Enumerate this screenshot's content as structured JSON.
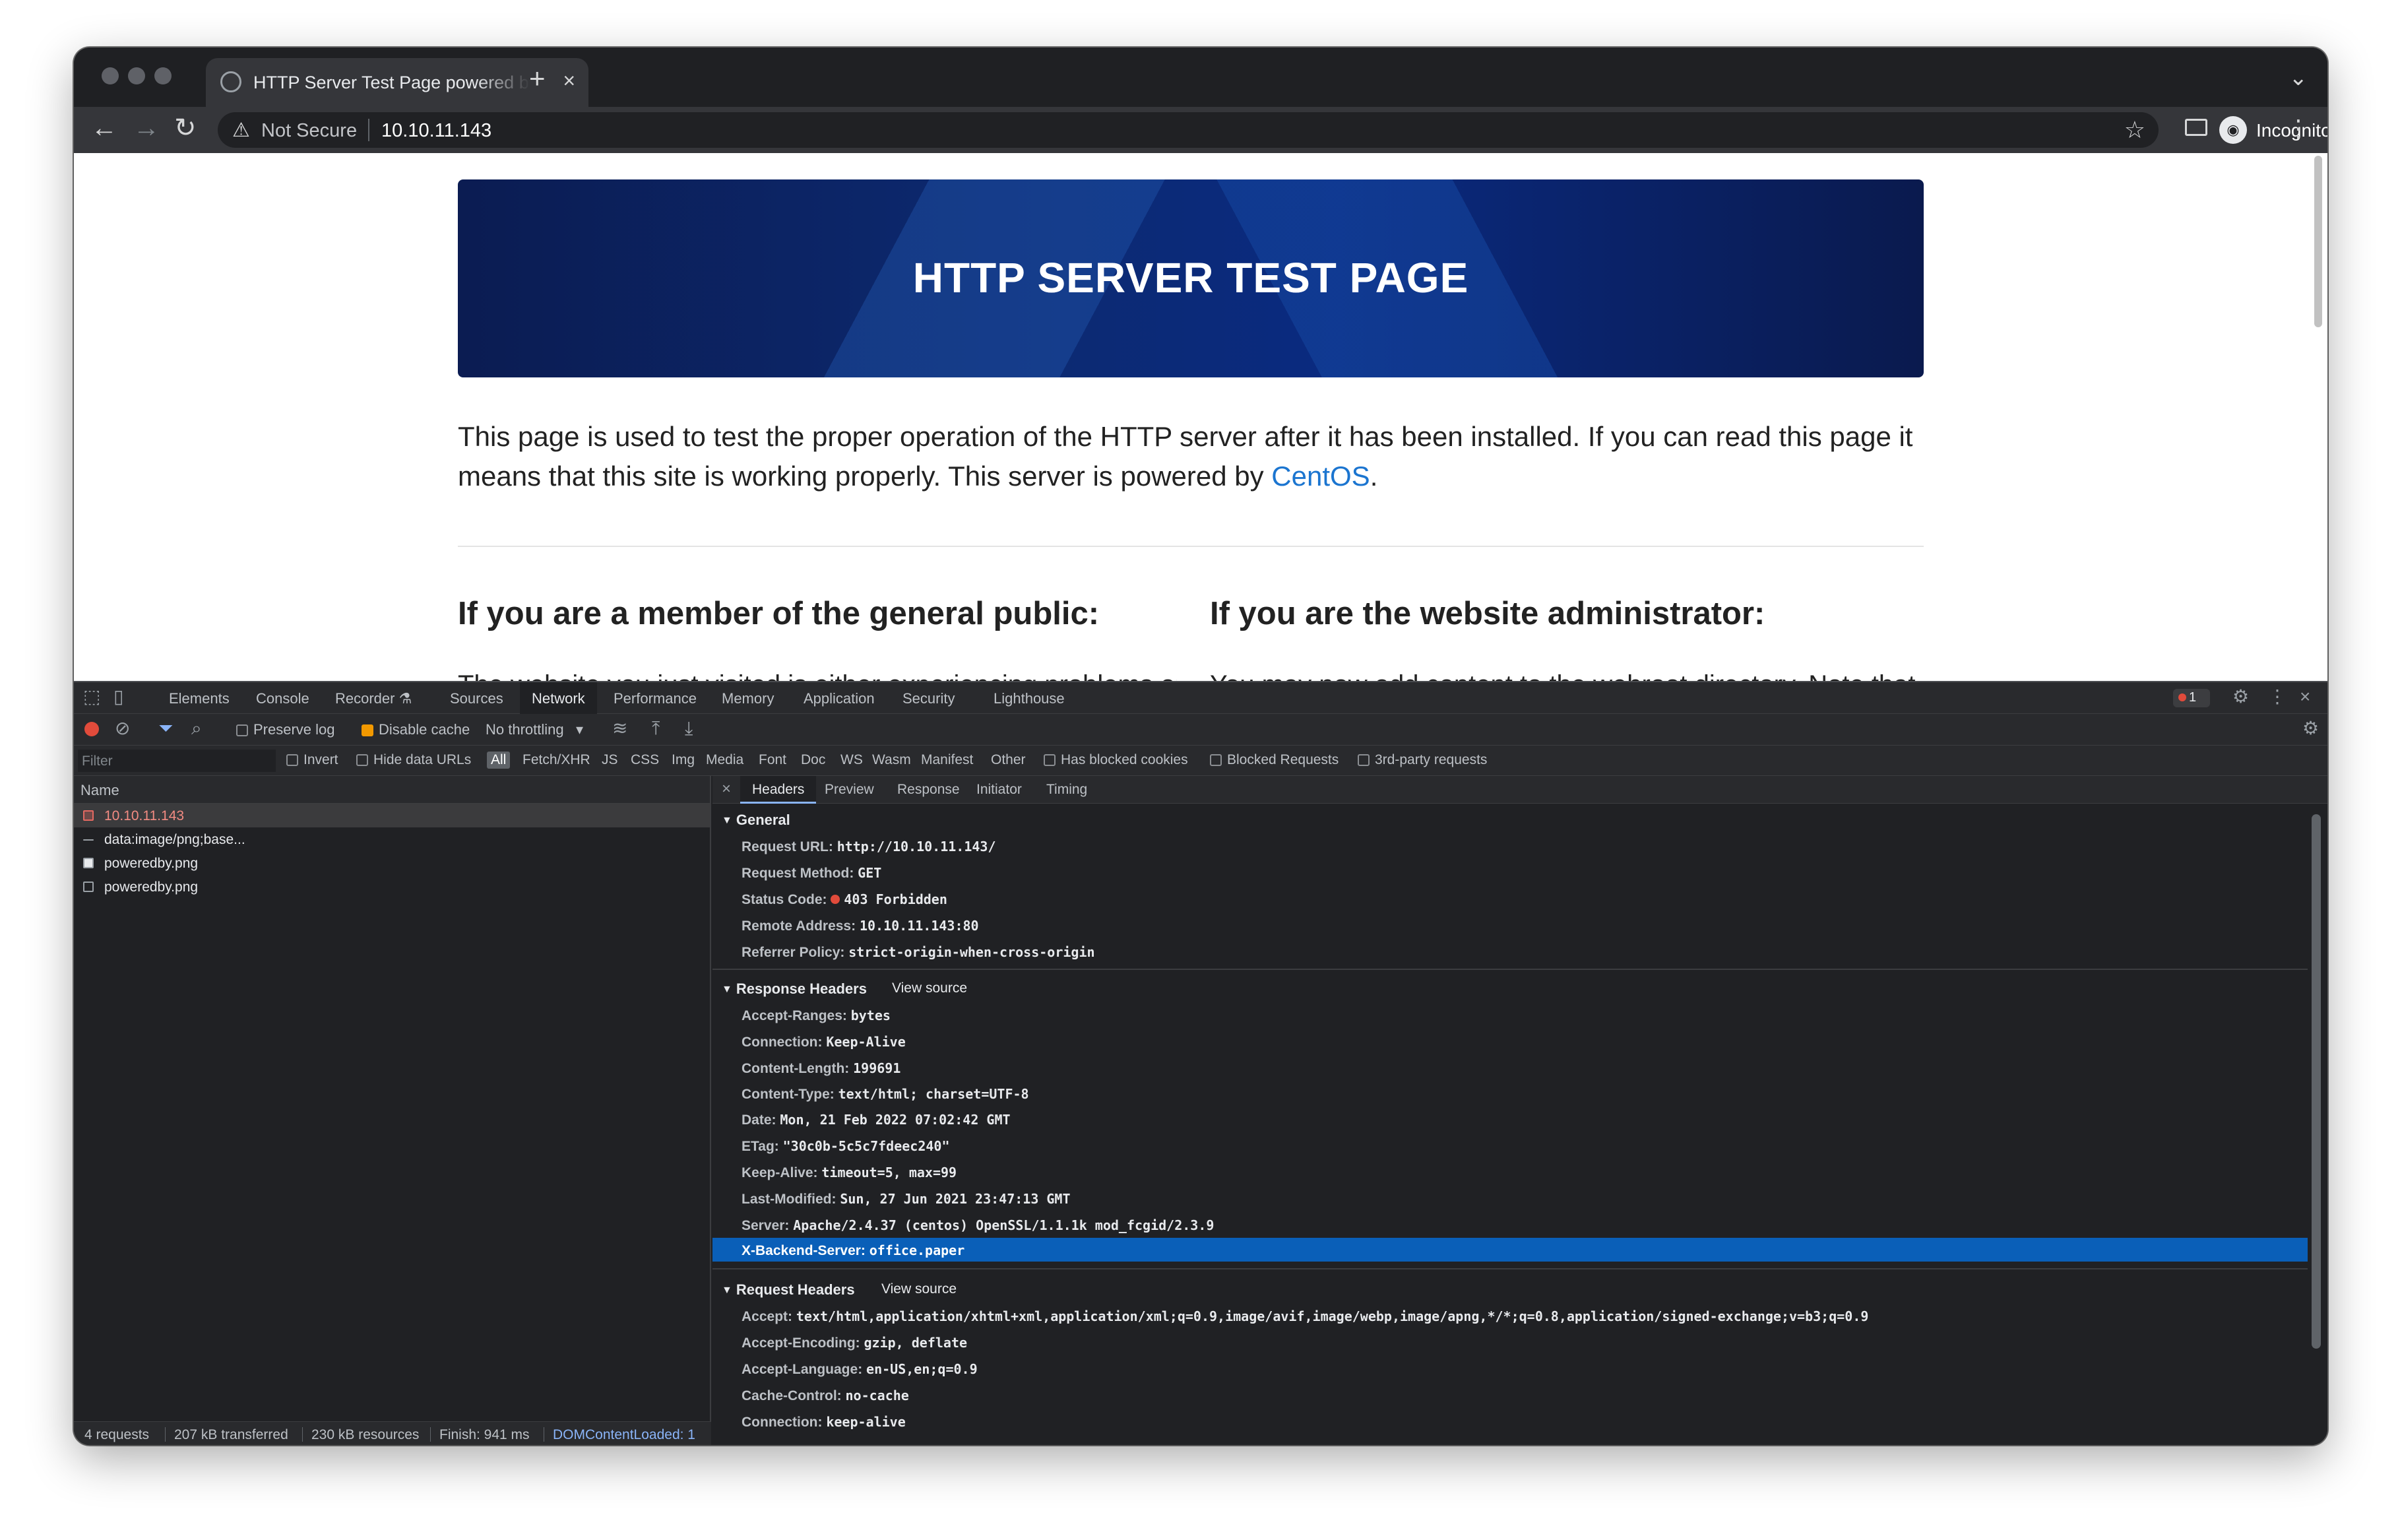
{
  "browser": {
    "tab_title": "HTTP Server Test Page powered by CentOS",
    "address": {
      "security_label": "Not Secure",
      "url": "10.10.11.143"
    },
    "profile_label": "Incognito"
  },
  "page": {
    "banner_title": "HTTP SERVER TEST PAGE",
    "intro_text": "This page is used to test the proper operation of the HTTP server after it has been installed. If you can read this page it means that this site is working properly. This server is powered by ",
    "intro_link": "CentOS",
    "intro_end": ".",
    "public_heading": "If you are a member of the general public:",
    "admin_heading": "If you are the website administrator:",
    "public_cut_text": "The website you just visited is either experiencing problems or",
    "admin_cut_text": "You may now add content to the webroot directory. Note that"
  },
  "devtools": {
    "tabs": [
      "Elements",
      "Console",
      "Recorder ⚗",
      "Sources",
      "Network",
      "Performance",
      "Memory",
      "Application",
      "Security",
      "Lighthouse"
    ],
    "active_tab": "Network",
    "error_count": "1",
    "toolbar": {
      "preserve_log": "Preserve log",
      "disable_cache": "Disable cache",
      "throttling": "No throttling"
    },
    "filter": {
      "placeholder": "Filter",
      "invert": "Invert",
      "hide_data_urls": "Hide data URLs",
      "types": [
        "All",
        "Fetch/XHR",
        "JS",
        "CSS",
        "Img",
        "Media",
        "Font",
        "Doc",
        "WS",
        "Wasm",
        "Manifest",
        "Other"
      ],
      "has_blocked_cookies": "Has blocked cookies",
      "blocked_requests": "Blocked Requests",
      "third_party": "3rd-party requests"
    },
    "requests": {
      "column": "Name",
      "rows": [
        "10.10.11.143",
        "data:image/png;base...",
        "poweredby.png",
        "poweredby.png"
      ]
    },
    "status_bar": {
      "requests": "4 requests",
      "transferred": "207 kB transferred",
      "resources": "230 kB resources",
      "finish": "Finish: 941 ms",
      "dom_loaded": "DOMContentLoaded: 1"
    },
    "details": {
      "tabs": [
        "Headers",
        "Preview",
        "Response",
        "Initiator",
        "Timing"
      ],
      "active_tab": "Headers",
      "view_source": "View source",
      "general": {
        "title": "General",
        "rows": [
          {
            "k": "Request URL:",
            "v": "http://10.10.11.143/"
          },
          {
            "k": "Request Method:",
            "v": "GET"
          },
          {
            "k": "Status Code:",
            "v": "403 Forbidden"
          },
          {
            "k": "Remote Address:",
            "v": "10.10.11.143:80"
          },
          {
            "k": "Referrer Policy:",
            "v": "strict-origin-when-cross-origin"
          }
        ]
      },
      "response": {
        "title": "Response Headers",
        "rows": [
          {
            "k": "Accept-Ranges:",
            "v": "bytes"
          },
          {
            "k": "Connection:",
            "v": "Keep-Alive"
          },
          {
            "k": "Content-Length:",
            "v": "199691"
          },
          {
            "k": "Content-Type:",
            "v": "text/html; charset=UTF-8"
          },
          {
            "k": "Date:",
            "v": "Mon, 21 Feb 2022 07:02:42 GMT"
          },
          {
            "k": "ETag:",
            "v": "\"30c0b-5c5c7fdeec240\""
          },
          {
            "k": "Keep-Alive:",
            "v": "timeout=5, max=99"
          },
          {
            "k": "Last-Modified:",
            "v": "Sun, 27 Jun 2021 23:47:13 GMT"
          },
          {
            "k": "Server:",
            "v": "Apache/2.4.37 (centos) OpenSSL/1.1.1k mod_fcgid/2.3.9"
          },
          {
            "k": "X-Backend-Server:",
            "v": "office.paper"
          }
        ]
      },
      "request": {
        "title": "Request Headers",
        "rows": [
          {
            "k": "Accept:",
            "v": "text/html,application/xhtml+xml,application/xml;q=0.9,image/avif,image/webp,image/apng,*/*;q=0.8,application/signed-exchange;v=b3;q=0.9"
          },
          {
            "k": "Accept-Encoding:",
            "v": "gzip, deflate"
          },
          {
            "k": "Accept-Language:",
            "v": "en-US,en;q=0.9"
          },
          {
            "k": "Cache-Control:",
            "v": "no-cache"
          },
          {
            "k": "Connection:",
            "v": "keep-alive"
          }
        ]
      }
    }
  }
}
